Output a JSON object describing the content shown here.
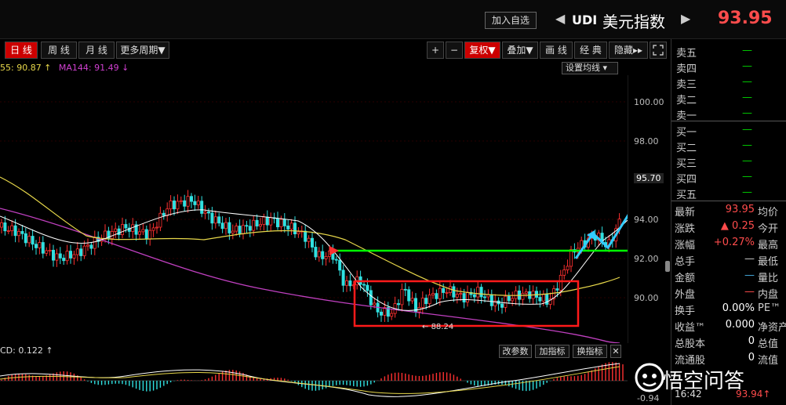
{
  "header": {
    "add_watchlist": "加入自选",
    "prev_arrow": "◀",
    "next_arrow": "▶",
    "code": "UDI",
    "name": "美元指数",
    "price": "93.95"
  },
  "periods": [
    "日 线",
    "周 线",
    "月 线",
    "更多周期▼"
  ],
  "tools": [
    "+",
    "−",
    "复权▼",
    "叠加▼",
    "画 线",
    "经 典",
    "隐藏▸▸"
  ],
  "ma": {
    "ma_a": "55: 90.87 ↑",
    "ma144": "MA144: 91.49 ↓",
    "set_button": "设置均线 ▾"
  },
  "yaxis": {
    "labels": [
      "100.00",
      "98.00",
      "95.70",
      "94.00",
      "92.00",
      "90.00"
    ]
  },
  "annotations": {
    "low_label": "88.24"
  },
  "macd": {
    "label": "CD: 0.122 ↑",
    "buttons": [
      "改参数",
      "加指标",
      "换指标",
      "✕"
    ],
    "min_label": "-0.94"
  },
  "orderbook": {
    "sell": [
      "卖五",
      "卖四",
      "卖三",
      "卖二",
      "卖一"
    ],
    "buy": [
      "买一",
      "买二",
      "买三",
      "买四",
      "买五"
    ],
    "dash": "—"
  },
  "quote": [
    {
      "l1": "最新",
      "v1": "93.95",
      "l2": "均价"
    },
    {
      "l1": "涨跌",
      "v1": "▲ 0.25",
      "l2": "今开"
    },
    {
      "l1": "涨幅",
      "v1": "+0.27%",
      "l2": "最高"
    },
    {
      "l1": "总手",
      "v1": "—",
      "l2": "最低"
    },
    {
      "l1": "金额",
      "v1": "—",
      "l2": "量比"
    },
    {
      "l1": "外盘",
      "v1": "—",
      "l2": "内盘"
    },
    {
      "l1": "换手",
      "v1": "0.00%",
      "l2": "PE™"
    },
    {
      "l1": "收益™",
      "v1": "0.000",
      "l2": "净资产"
    },
    {
      "l1": "总股本",
      "v1": "0",
      "l2": "总值"
    },
    {
      "l1": "流通股",
      "v1": "0",
      "l2": "流值"
    }
  ],
  "bottom": {
    "time": "16:42",
    "price": "93.94↑"
  },
  "watermark": "悟空问答"
}
